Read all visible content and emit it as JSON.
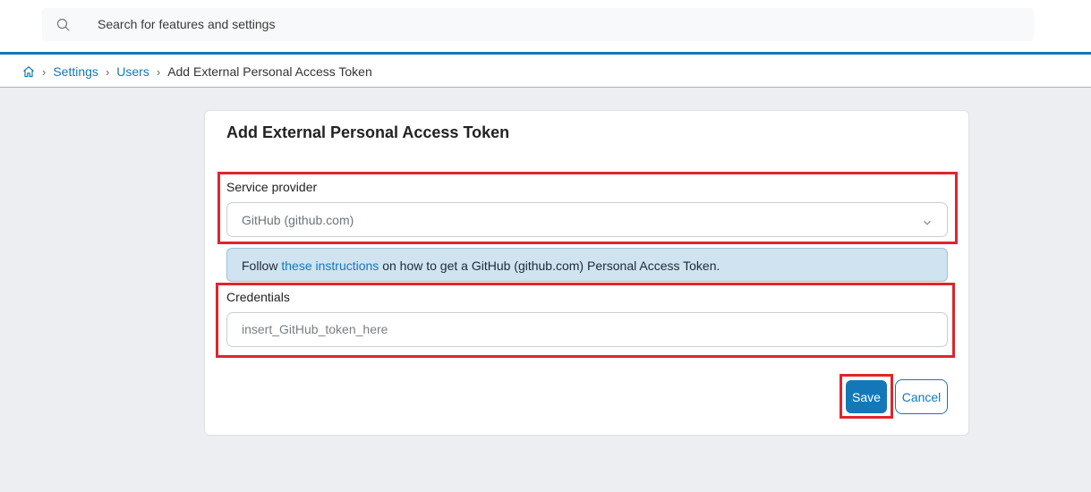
{
  "search": {
    "placeholder": "Search for features and settings"
  },
  "breadcrumb": {
    "items": [
      "Settings",
      "Users"
    ],
    "current": "Add External Personal Access Token"
  },
  "form": {
    "title": "Add External Personal Access Token",
    "service_provider": {
      "label": "Service provider",
      "selected": "GitHub (github.com)"
    },
    "info": {
      "prefix": "Follow ",
      "link_text": "these instructions",
      "suffix": " on how to get a GitHub (github.com) Personal Access Token."
    },
    "credentials": {
      "label": "Credentials",
      "value": "",
      "placeholder": "insert_GitHub_token_here"
    },
    "save_label": "Save",
    "cancel_label": "Cancel"
  },
  "colors": {
    "accent": "#1478b8",
    "highlight": "#e0252b",
    "info_bg": "#cfe3f1"
  },
  "icons": [
    "search-icon",
    "home-icon",
    "chevron-down-icon"
  ]
}
